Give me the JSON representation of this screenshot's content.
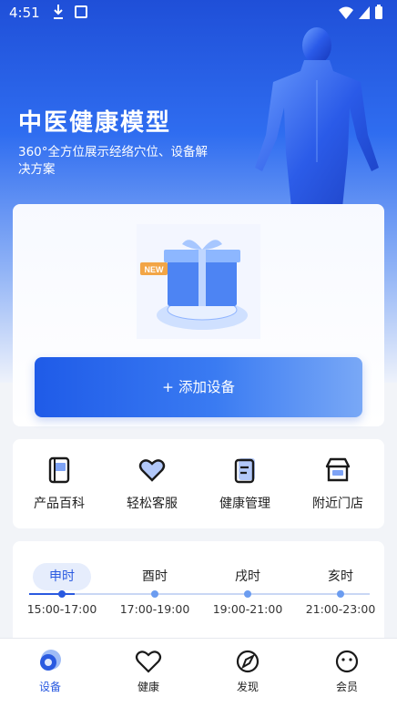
{
  "status_bar": {
    "time": "4:51"
  },
  "hero": {
    "title": "中医健康模型",
    "subtitle": "360°全方位展示经络穴位、设备解决方案"
  },
  "device_card": {
    "illustration_badge": "NEW",
    "add_button_label": "+ 添加设备"
  },
  "quick_actions": [
    {
      "label": "产品百科",
      "icon": "book-icon"
    },
    {
      "label": "轻松客服",
      "icon": "heart-icon"
    },
    {
      "label": "健康管理",
      "icon": "clipboard-icon"
    },
    {
      "label": "附近门店",
      "icon": "store-icon"
    }
  ],
  "meridian_clock": {
    "periods": [
      {
        "name": "申时",
        "range": "15:00-17:00",
        "active": true
      },
      {
        "name": "酉时",
        "range": "17:00-19:00",
        "active": false
      },
      {
        "name": "戌时",
        "range": "19:00-21:00",
        "active": false
      },
      {
        "name": "亥时",
        "range": "21:00-23:00",
        "active": false
      }
    ]
  },
  "tab_bar": {
    "tabs": [
      {
        "label": "设备",
        "icon": "device-icon",
        "active": true
      },
      {
        "label": "健康",
        "icon": "heart-outline-icon",
        "active": false
      },
      {
        "label": "发现",
        "icon": "compass-icon",
        "active": false
      },
      {
        "label": "会员",
        "icon": "smile-icon",
        "active": false
      }
    ]
  },
  "colors": {
    "accent": "#2a5ae0",
    "hero_top": "#1f4fd8",
    "button_gradient_start": "#1f5be8",
    "button_gradient_end": "#79a8f6"
  }
}
